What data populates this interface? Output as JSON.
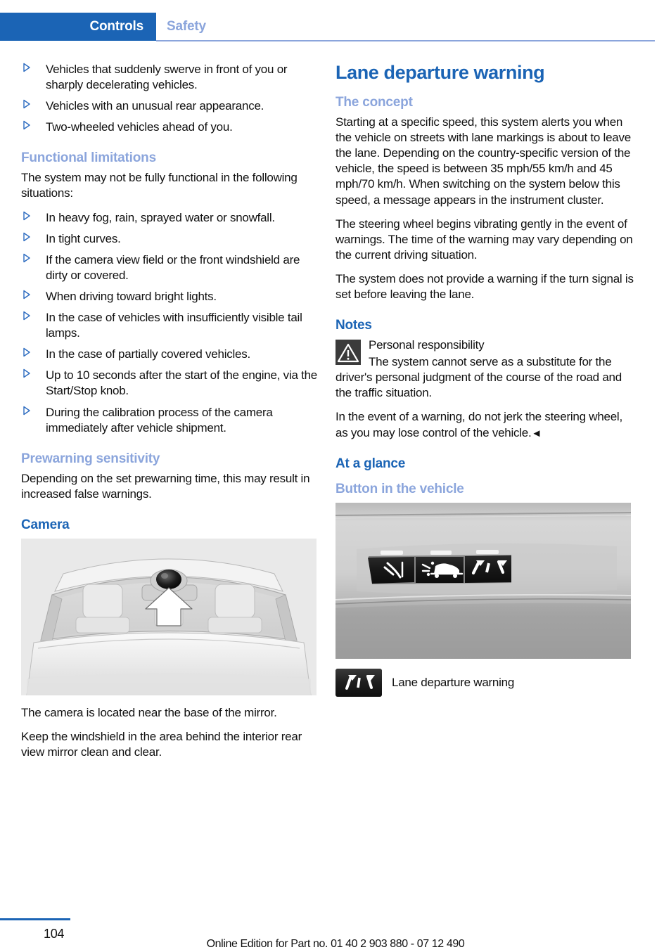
{
  "colors": {
    "tab_blue": "#1b64b5",
    "heading_blue": "#1b64b5",
    "subheading_blue": "#8ba5dc",
    "bullet_blue": "#2d6cc0",
    "warning_icon_bg": "#3b3b3b",
    "button_black": "#2c2c2c"
  },
  "header": {
    "tab_label": "Controls",
    "chapter_label": "Safety"
  },
  "left_column": {
    "top_bullets": [
      "Vehicles that suddenly swerve in front of you or sharply decelerating vehicles.",
      "Vehicles with an unusual rear appearance.",
      "Two-wheeled vehicles ahead of you."
    ],
    "functional_limitations": {
      "heading": "Functional limitations",
      "intro": "The system may not be fully functional in the following situations:",
      "bullets": [
        "In heavy fog, rain, sprayed water or snowfall.",
        "In tight curves.",
        "If the camera view field or the front windshield are dirty or covered.",
        "When driving toward bright lights.",
        "In the case of vehicles with insufficiently visible tail lamps.",
        "In the case of partially covered vehicles.",
        "Up to 10 seconds after the start of the engine, via the Start/Stop knob.",
        "During the calibration process of the camera immediately after vehicle shipment."
      ]
    },
    "prewarning_sensitivity": {
      "heading": "Prewarning sensitivity",
      "body": "Depending on the set prewarning time, this may result in increased false warnings."
    },
    "camera": {
      "heading": "Camera",
      "figure_caption": "camera-behind-windshield-illustration",
      "paragraphs": [
        "The camera is located near the base of the mirror.",
        "Keep the windshield in the area behind the interior rear view mirror clean and clear."
      ]
    }
  },
  "right_column": {
    "title": "Lane departure warning",
    "the_concept": {
      "heading": "The concept",
      "paragraphs": [
        "Starting at a specific speed, this system alerts you when the vehicle on streets with lane markings is about to leave the lane. Depending on the country-specific version of the vehicle, the speed is between 35 mph/55 km/h and 45 mph/70 km/h. When switching on the system below this speed, a message appears in the instrument cluster.",
        "The steering wheel begins vibrating gently in the event of warnings. The time of the warning may vary depending on the current driving situation.",
        "The system does not provide a warning if the turn signal is set before leaving the lane."
      ],
      "speed_low_mph": "35 mph/55 km/h",
      "speed_high_mph": "45 mph/70 km/h"
    },
    "notes": {
      "heading": "Notes",
      "warning_title": "Personal responsibility",
      "warning_body": "The system cannot serve as a substitute for the driver's personal judgment of the course of the road and the traffic situation.",
      "closing_paragraph": "In the event of a warning, do not jerk the steering wheel, as you may lose control of the vehicle.",
      "end_marker": "◄"
    },
    "at_a_glance": {
      "heading": "At a glance",
      "button_heading": "Button in the vehicle",
      "figure_caption": "dashboard-buttons-photo",
      "legend_label": "Lane departure warning"
    }
  },
  "footer": {
    "page_number": "104",
    "edition_text": "Online Edition for Part no. 01 40 2 903 880 - 07 12 490"
  }
}
